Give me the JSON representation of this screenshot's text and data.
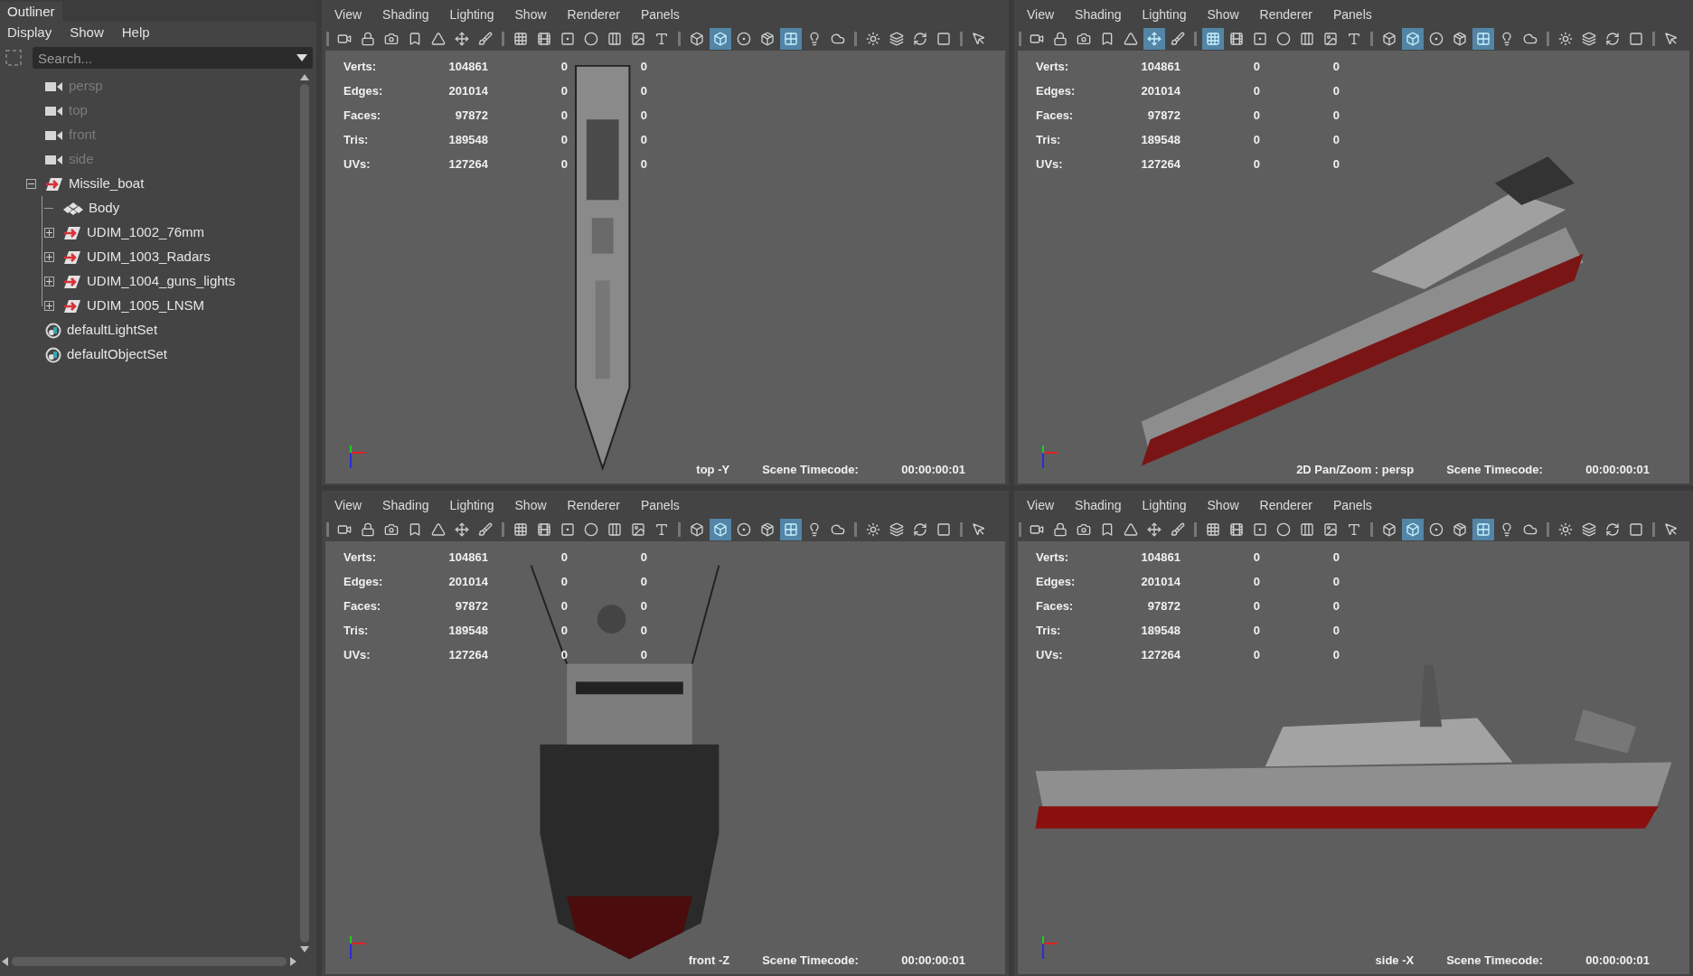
{
  "outliner": {
    "title": "Outliner",
    "menu": [
      "Display",
      "Show",
      "Help"
    ],
    "search": {
      "placeholder": "Search..."
    },
    "tree": [
      {
        "label": "persp",
        "kind": "camera",
        "dimmed": true
      },
      {
        "label": "top",
        "kind": "camera",
        "dimmed": true
      },
      {
        "label": "front",
        "kind": "camera",
        "dimmed": true
      },
      {
        "label": "side",
        "kind": "camera",
        "dimmed": true
      },
      {
        "label": "Missile_boat",
        "kind": "group",
        "dimmed": false,
        "expanded": true,
        "children": [
          {
            "label": "Body",
            "kind": "mesh",
            "dimmed": false
          },
          {
            "label": "UDIM_1002_76mm",
            "kind": "group",
            "dimmed": false,
            "expanded": false
          },
          {
            "label": "UDIM_1003_Radars",
            "kind": "group",
            "dimmed": false,
            "expanded": false
          },
          {
            "label": "UDIM_1004_guns_lights",
            "kind": "group",
            "dimmed": false,
            "expanded": false
          },
          {
            "label": "UDIM_1005_LNSM",
            "kind": "group",
            "dimmed": false,
            "expanded": false
          }
        ]
      },
      {
        "label": "defaultLightSet",
        "kind": "set",
        "dimmed": false
      },
      {
        "label": "defaultObjectSet",
        "kind": "set",
        "dimmed": false
      }
    ]
  },
  "panels": [
    {
      "kind": "top",
      "menu": [
        "View",
        "Shading",
        "Lighting",
        "Show",
        "Renderer",
        "Panels"
      ],
      "toolbar": [
        false,
        false,
        false,
        false,
        false,
        false,
        false,
        false,
        false,
        false,
        false,
        false,
        false,
        false,
        false,
        true,
        false,
        false,
        true,
        false,
        false,
        false,
        false,
        false,
        false,
        false
      ],
      "stats": [
        {
          "label": "Verts:",
          "values": [
            "104861",
            "0",
            "0"
          ]
        },
        {
          "label": "Edges:",
          "values": [
            "201014",
            "0",
            "0"
          ]
        },
        {
          "label": "Faces:",
          "values": [
            "97872",
            "0",
            "0"
          ]
        },
        {
          "label": "Tris:",
          "values": [
            "189548",
            "0",
            "0"
          ]
        },
        {
          "label": "UVs:",
          "values": [
            "127264",
            "0",
            "0"
          ]
        }
      ],
      "camera_label": "top -Y",
      "timecode_label": "Scene Timecode:",
      "timecode": "00:00:00:01"
    },
    {
      "kind": "persp",
      "menu": [
        "View",
        "Shading",
        "Lighting",
        "Show",
        "Renderer",
        "Panels"
      ],
      "toolbar": [
        false,
        false,
        false,
        false,
        false,
        true,
        false,
        true,
        false,
        false,
        false,
        false,
        false,
        false,
        false,
        true,
        false,
        false,
        true,
        false,
        false,
        false,
        false,
        false,
        false,
        false
      ],
      "stats": [
        {
          "label": "Verts:",
          "values": [
            "104861",
            "0",
            "0"
          ]
        },
        {
          "label": "Edges:",
          "values": [
            "201014",
            "0",
            "0"
          ]
        },
        {
          "label": "Faces:",
          "values": [
            "97872",
            "0",
            "0"
          ]
        },
        {
          "label": "Tris:",
          "values": [
            "189548",
            "0",
            "0"
          ]
        },
        {
          "label": "UVs:",
          "values": [
            "127264",
            "0",
            "0"
          ]
        }
      ],
      "camera_label": "2D Pan/Zoom : persp",
      "timecode_label": "Scene Timecode:",
      "timecode": "00:00:00:01"
    },
    {
      "kind": "front",
      "menu": [
        "View",
        "Shading",
        "Lighting",
        "Show",
        "Renderer",
        "Panels"
      ],
      "toolbar": [
        false,
        false,
        false,
        false,
        false,
        false,
        false,
        false,
        false,
        false,
        false,
        false,
        false,
        false,
        false,
        true,
        false,
        false,
        true,
        false,
        false,
        false,
        false,
        false,
        false,
        false
      ],
      "stats": [
        {
          "label": "Verts:",
          "values": [
            "104861",
            "0",
            "0"
          ]
        },
        {
          "label": "Edges:",
          "values": [
            "201014",
            "0",
            "0"
          ]
        },
        {
          "label": "Faces:",
          "values": [
            "97872",
            "0",
            "0"
          ]
        },
        {
          "label": "Tris:",
          "values": [
            "189548",
            "0",
            "0"
          ]
        },
        {
          "label": "UVs:",
          "values": [
            "127264",
            "0",
            "0"
          ]
        }
      ],
      "camera_label": "front -Z",
      "timecode_label": "Scene Timecode:",
      "timecode": "00:00:00:01"
    },
    {
      "kind": "side",
      "menu": [
        "View",
        "Shading",
        "Lighting",
        "Show",
        "Renderer",
        "Panels"
      ],
      "toolbar": [
        false,
        false,
        false,
        false,
        false,
        false,
        false,
        false,
        false,
        false,
        false,
        false,
        false,
        false,
        false,
        true,
        false,
        false,
        true,
        false,
        false,
        false,
        false,
        false,
        false,
        false
      ],
      "stats": [
        {
          "label": "Verts:",
          "values": [
            "104861",
            "0",
            "0"
          ]
        },
        {
          "label": "Edges:",
          "values": [
            "201014",
            "0",
            "0"
          ]
        },
        {
          "label": "Faces:",
          "values": [
            "97872",
            "0",
            "0"
          ]
        },
        {
          "label": "Tris:",
          "values": [
            "189548",
            "0",
            "0"
          ]
        },
        {
          "label": "UVs:",
          "values": [
            "127264",
            "0",
            "0"
          ]
        }
      ],
      "camera_label": "side -X",
      "timecode_label": "Scene Timecode:",
      "timecode": "00:00:00:01"
    }
  ]
}
